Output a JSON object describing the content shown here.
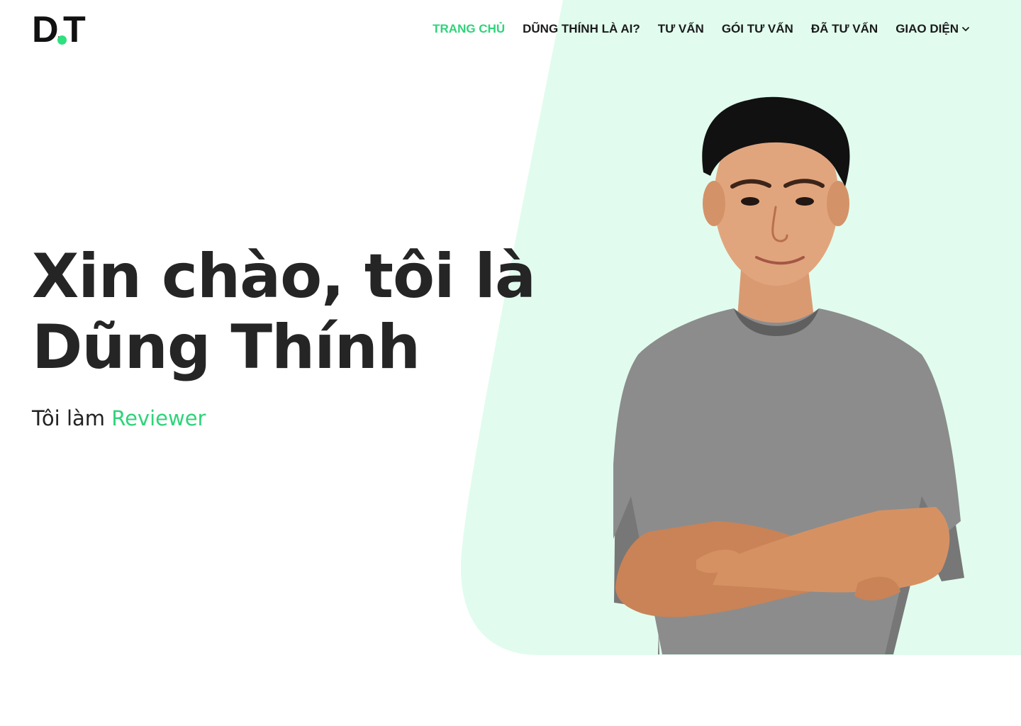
{
  "brand": {
    "logo_text": "D.T",
    "accent_color": "#2FD37A",
    "background_accent": "#E1FCEE"
  },
  "nav": {
    "items": [
      {
        "label": "TRANG CHỦ",
        "active": true
      },
      {
        "label": "DŨNG THÍNH LÀ AI?",
        "active": false
      },
      {
        "label": "TƯ VẤN",
        "active": false
      },
      {
        "label": "GÓI TƯ VẤN",
        "active": false
      },
      {
        "label": "ĐÃ TƯ VẤN",
        "active": false
      },
      {
        "label": "GIAO DIỆN",
        "active": false,
        "has_dropdown": true,
        "icon": "chevron-down-icon"
      }
    ]
  },
  "hero": {
    "title_line_1": "Xin chào, tôi là",
    "title_line_2": "Dũng Thính",
    "subtitle_prefix": "Tôi làm",
    "subtitle_role": "Reviewer"
  }
}
